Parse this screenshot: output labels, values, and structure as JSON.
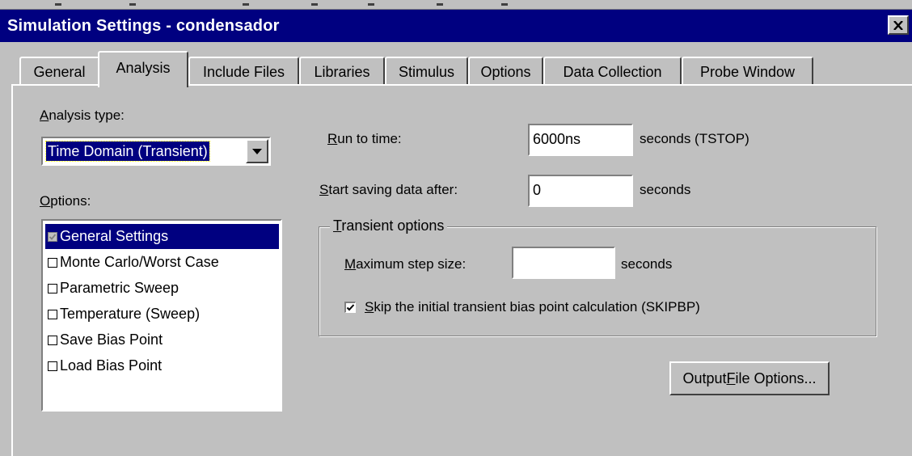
{
  "window": {
    "title": "Simulation Settings - condensador",
    "close_icon": "close-icon"
  },
  "tabs": [
    {
      "label": "General"
    },
    {
      "label": "Analysis",
      "active": true
    },
    {
      "label": "Include Files"
    },
    {
      "label": "Libraries"
    },
    {
      "label": "Stimulus"
    },
    {
      "label": "Options"
    },
    {
      "label": "Data Collection"
    },
    {
      "label": "Probe Window"
    }
  ],
  "analysis": {
    "type_label": {
      "u": "A",
      "rest": "nalysis type:"
    },
    "type_value": "Time Domain (Transient)",
    "options_label": {
      "u": "O",
      "rest": "ptions:"
    },
    "options": [
      {
        "label": "General Settings",
        "checked": true,
        "selected": true
      },
      {
        "label": "Monte Carlo/Worst Case",
        "checked": false
      },
      {
        "label": "Parametric Sweep",
        "checked": false
      },
      {
        "label": "Temperature (Sweep)",
        "checked": false
      },
      {
        "label": "Save Bias Point",
        "checked": false
      },
      {
        "label": "Load Bias Point",
        "checked": false
      }
    ]
  },
  "run_to_time": {
    "label": {
      "u": "R",
      "rest": "un to time:"
    },
    "value": "6000ns",
    "units": "seconds  (TSTOP)"
  },
  "start_saving": {
    "label": {
      "u": "S",
      "rest": "tart saving data after:"
    },
    "value": "0",
    "units": "seconds"
  },
  "transient_options": {
    "title": {
      "u": "T",
      "rest": "ransient options"
    },
    "max_step_label": {
      "u": "M",
      "rest": "aximum step size:"
    },
    "max_step_value": "",
    "max_step_units": "seconds",
    "skip_label": {
      "u": "S",
      "rest": "kip the initial transient bias point calculation  (SKIPBP)"
    },
    "skip_checked": true
  },
  "output_button": {
    "pre": "Output ",
    "u": "F",
    "rest": "ile Options..."
  },
  "colors": {
    "title_bar": "#000080",
    "face": "#c0c0c0",
    "selection": "#000080"
  }
}
